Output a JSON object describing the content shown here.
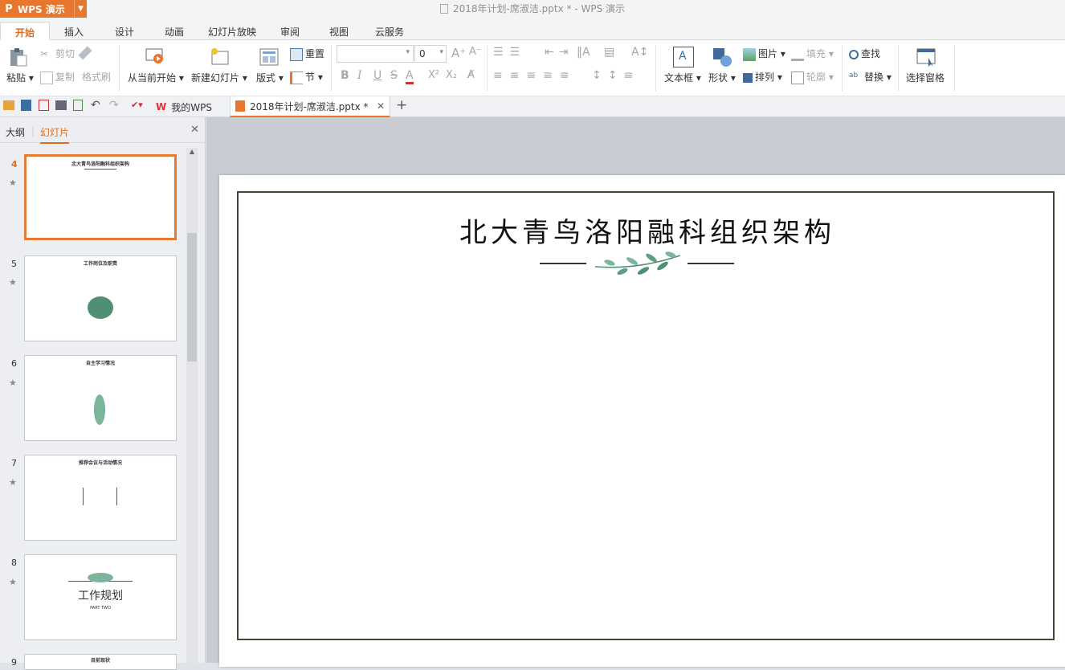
{
  "app": {
    "logo_letter": "P",
    "logo_text": "WPS 演示",
    "window_title": "2018年计划-席淑洁.pptx * - WPS 演示"
  },
  "tabs": [
    "开始",
    "插入",
    "设计",
    "动画",
    "幻灯片放映",
    "审阅",
    "视图",
    "云服务"
  ],
  "ribbon": {
    "paste": "粘贴",
    "cut": "剪切",
    "copy": "复制",
    "format_painter": "格式刷",
    "from_current": "从当前开始",
    "new_slide": "新建幻灯片",
    "layout": "版式",
    "reset": "重置",
    "section": "节",
    "font_size": "0",
    "text_box": "文本框",
    "shape": "形状",
    "picture": "图片",
    "fill": "填充",
    "arrange": "排列",
    "outline": "轮廓",
    "find": "查找",
    "replace": "替换",
    "selection_pane": "选择窗格",
    "bold": "B",
    "italic": "I",
    "underline": "U",
    "strike": "S"
  },
  "doc_tabs": {
    "my_wps": "我的WPS",
    "current": "2018年计划-席淑洁.pptx *"
  },
  "sidebar": {
    "outline_tab": "大纲",
    "slides_tab": "幻灯片",
    "thumbs": [
      {
        "num": "4",
        "title": "北大青鸟洛阳融科组织架构"
      },
      {
        "num": "5",
        "title": "工作岗位及职责"
      },
      {
        "num": "6",
        "title": "自主学习情况"
      },
      {
        "num": "7",
        "title": "推荐会议与活动情况"
      },
      {
        "num": "8",
        "title": "工作规划",
        "sub": "PART TWO"
      },
      {
        "num": "9",
        "title": "目前现状"
      }
    ]
  },
  "slide": {
    "title": "北大青鸟洛阳融科组织架构"
  },
  "colors": {
    "accent": "#e8762c",
    "leaf": "#4f8f73",
    "frame": "#3e4a36"
  }
}
